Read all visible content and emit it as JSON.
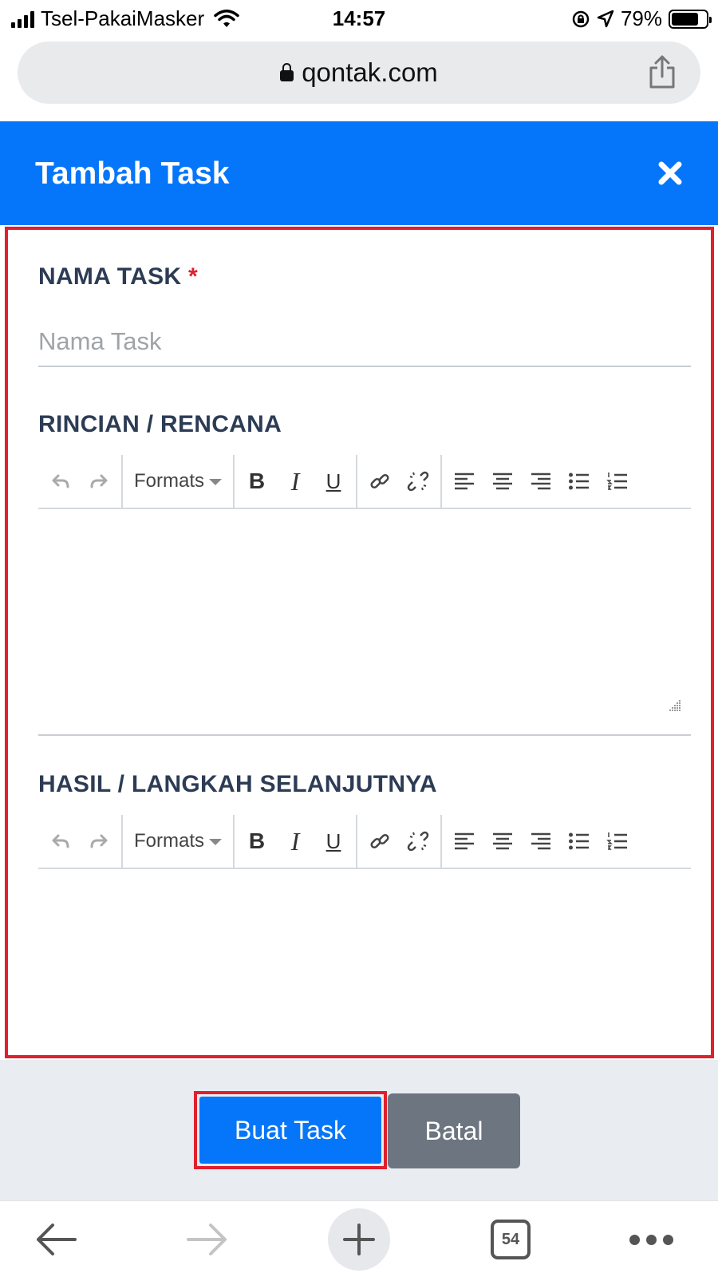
{
  "status_bar": {
    "carrier": "Tsel-PakaiMasker",
    "time": "14:57",
    "battery": "79%",
    "battery_level": 0.79
  },
  "browser": {
    "url": "qontak.com",
    "tab_count": "54"
  },
  "modal": {
    "title": "Tambah Task",
    "close_icon": "close-icon",
    "task_name_label": "NAMA TASK",
    "required_mark": "*",
    "task_name_placeholder": "Nama Task",
    "task_name_value": "",
    "details_label": "RINCIAN / RENCANA",
    "result_label": "HASIL / LANGKAH SELANJUTNYA",
    "toolbar": {
      "formats_label": "Formats",
      "bold": "B",
      "italic": "I",
      "underline": "U"
    },
    "submit_label": "Buat Task",
    "cancel_label": "Batal"
  },
  "colors": {
    "primary": "#0576f9",
    "highlight_border": "#e0202d",
    "cancel_button": "#6d7580",
    "label_text": "#2d3c55"
  }
}
